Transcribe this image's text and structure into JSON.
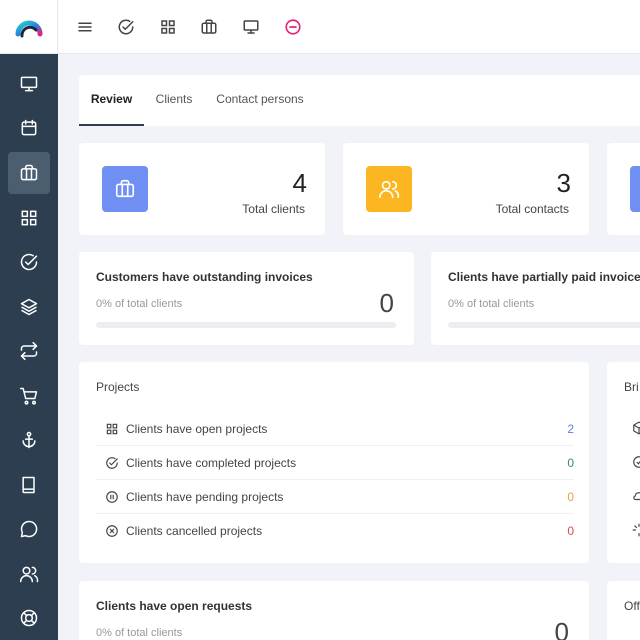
{
  "colors": {
    "sidebar": "#2c3e50",
    "accent_blue": "#6f8ff2",
    "accent_yellow": "#fbb621",
    "blue_number": "#5b7fdc",
    "green_number": "#3b8a6e",
    "orange_number": "#e8a040",
    "red_number": "#d64a5a"
  },
  "topbar": {
    "icons": [
      "menu-icon",
      "check-circle-icon",
      "grid-icon",
      "briefcase-icon",
      "monitor-icon",
      "minus-circle-icon"
    ]
  },
  "sidebar": {
    "items": [
      "monitor-icon",
      "calendar-icon",
      "briefcase-icon",
      "grid-icon",
      "check-circle-icon",
      "layers-icon",
      "repeat-icon",
      "cart-icon",
      "anchor-icon",
      "book-icon",
      "chat-icon",
      "users-icon",
      "lifebuoy-icon"
    ],
    "active_index": 2
  },
  "tabs": [
    {
      "label": "Review",
      "active": true
    },
    {
      "label": "Clients",
      "active": false
    },
    {
      "label": "Contact persons",
      "active": false
    }
  ],
  "stats": [
    {
      "value": "4",
      "label": "Total clients"
    },
    {
      "value": "3",
      "label": "Total contacts"
    }
  ],
  "invoices": [
    {
      "title": "Customers have outstanding invoices",
      "subtitle": "0% of total clients",
      "value": "0",
      "progress": 0
    },
    {
      "title": "Clients have partially paid invoices",
      "subtitle": "0% of total clients",
      "progress": 0
    }
  ],
  "projects": {
    "title": "Projects",
    "rows": [
      {
        "label": "Clients have open projects",
        "value": "2",
        "icon": "grid-icon"
      },
      {
        "label": "Clients have completed projects",
        "value": "0",
        "icon": "check-circle-icon"
      },
      {
        "label": "Clients have pending projects",
        "value": "0",
        "icon": "pause-circle-icon"
      },
      {
        "label": "Clients cancelled projects",
        "value": "0",
        "icon": "x-circle-icon"
      }
    ]
  },
  "right_card": {
    "title": "Bri"
  },
  "requests": {
    "title": "Clients have open requests",
    "subtitle": "0% of total clients",
    "value": "0"
  },
  "bottom_right": {
    "title": "Off"
  }
}
